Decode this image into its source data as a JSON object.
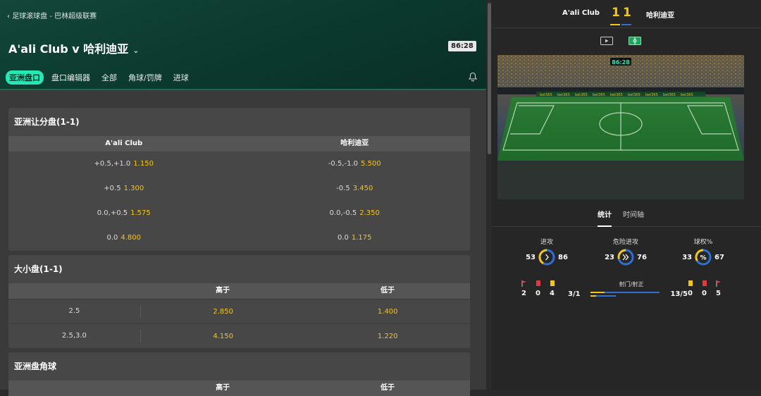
{
  "header": {
    "breadcrumb": "足球滚球盘 - 巴林超级联赛",
    "match_title": "A'ali Club v 哈利迪亚",
    "clock": "86:28"
  },
  "tabs": [
    {
      "label": "亚洲盘口",
      "active": true
    },
    {
      "label": "盘口编辑器"
    },
    {
      "label": "全部"
    },
    {
      "label": "角球/罚牌"
    },
    {
      "label": "进球"
    }
  ],
  "asian_handicap": {
    "title": "亚洲让分盘(1-1)",
    "home": "A'ali Club",
    "away": "哈利迪亚",
    "rows": [
      {
        "home_line": "+0.5,+1.0",
        "home_price": "1.150",
        "away_line": "-0.5,-1.0",
        "away_price": "5.500"
      },
      {
        "home_line": "+0.5",
        "home_price": "1.300",
        "away_line": "-0.5",
        "away_price": "3.450"
      },
      {
        "home_line": "0.0,+0.5",
        "home_price": "1.575",
        "away_line": "0.0,-0.5",
        "away_price": "2.350"
      },
      {
        "home_line": "0.0",
        "home_price": "4.800",
        "away_line": "0.0",
        "away_price": "1.175"
      }
    ]
  },
  "over_under": {
    "title": "大小盘(1-1)",
    "over": "高于",
    "under": "低于",
    "rows": [
      {
        "line": "2.5",
        "over": "2.850",
        "under": "1.400"
      },
      {
        "line": "2.5,3.0",
        "over": "4.150",
        "under": "1.220"
      }
    ]
  },
  "asian_corners": {
    "title": "亚洲盘角球",
    "over": "高于",
    "under": "低于"
  },
  "live": {
    "home": "A'ali Club",
    "away": "哈利迪亚",
    "home_score": "1",
    "away_score": "1",
    "pitch_clock": "86:28",
    "board_text": "bet365",
    "tabs": [
      "统计",
      "时间轴"
    ],
    "stats": {
      "attacks": {
        "label": "进攻",
        "home": "53",
        "away": "86"
      },
      "dangerous": {
        "label": "危险进攻",
        "home": "23",
        "away": "76"
      },
      "possession": {
        "label": "球权%",
        "home": "33",
        "away": "67"
      }
    },
    "home_cards": {
      "corners": "2",
      "red": "0",
      "yellow": "4"
    },
    "away_cards": {
      "yellow": "0",
      "red": "0",
      "corners": "5"
    },
    "shots": {
      "label": "射门/射正",
      "home": "3/1",
      "away": "13/5"
    },
    "colors": {
      "home": "#f5c518",
      "away": "#2f6fd6"
    }
  }
}
